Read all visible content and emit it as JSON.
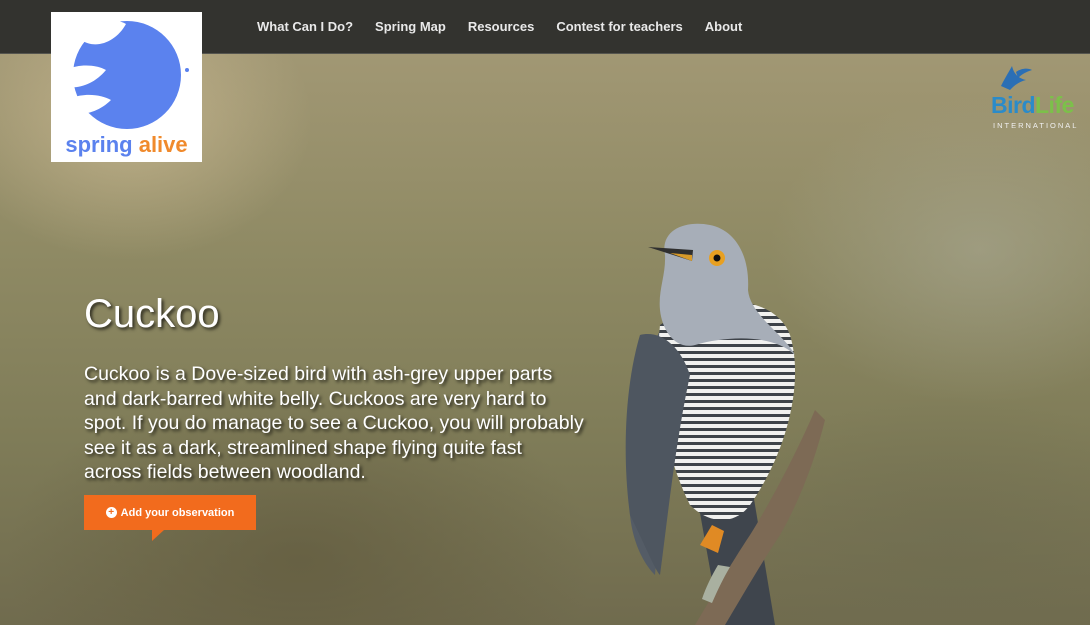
{
  "nav": {
    "items": [
      {
        "label": "What Can I Do?"
      },
      {
        "label": "Spring Map"
      },
      {
        "label": "Resources"
      },
      {
        "label": "Contest for teachers"
      },
      {
        "label": "About"
      }
    ]
  },
  "logo": {
    "word1": "spring",
    "word2": "alive"
  },
  "partner": {
    "word1": "Bird",
    "word2": "Life",
    "sub": "INTERNATIONAL"
  },
  "hero": {
    "title": "Cuckoo",
    "description": "Cuckoo is a Dove-sized bird with ash-grey upper parts and dark-barred white belly. Cuckoos are very hard to spot. If you do manage to see a Cuckoo, you will probably see it as a dark, streamlined shape flying quite fast across fields between woodland.",
    "cta_label": "Add your observation"
  },
  "colors": {
    "topbar": "#33332f",
    "accent": "#f26b1d",
    "logo_blue": "#5b82ee",
    "logo_orange": "#f08a2c"
  },
  "icons": {
    "cta": "plus-circle-icon",
    "logo": "bird-icon",
    "partner": "flying-bird-icon"
  }
}
